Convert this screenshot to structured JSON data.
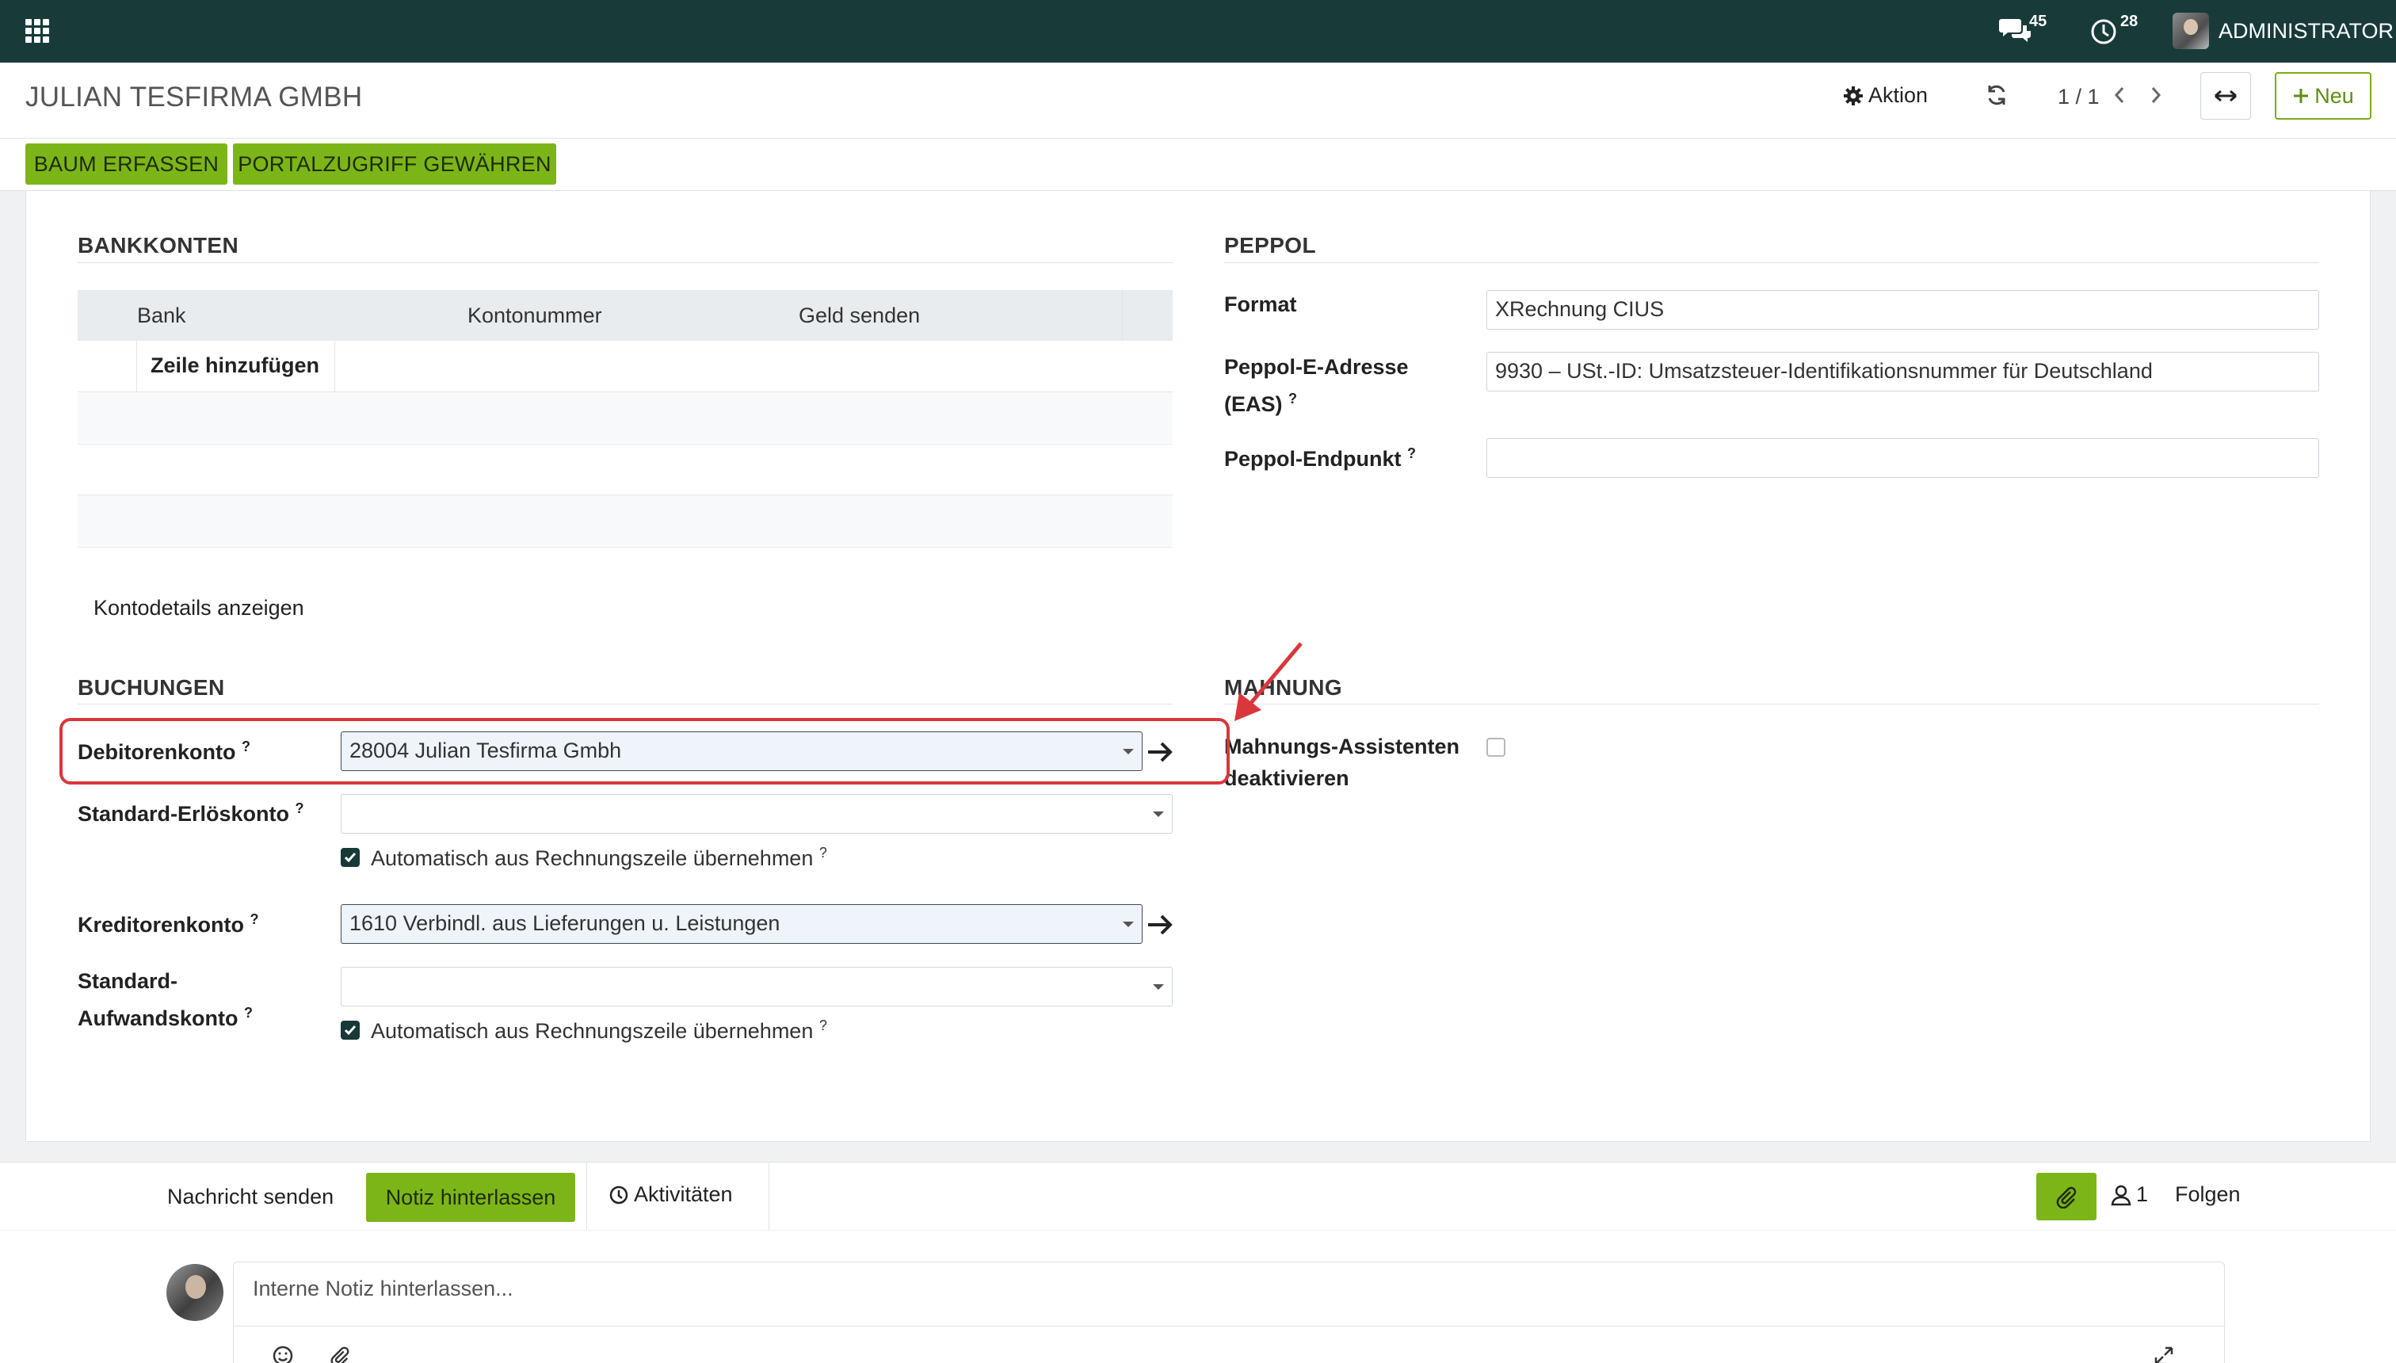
{
  "navbar": {
    "messages_count": "45",
    "activities_count": "28",
    "user_name": "ADMINISTRATOR"
  },
  "control_panel": {
    "record_title": "JULIAN TESFIRMA GMBH",
    "action_label": "Aktion",
    "pager": "1 / 1",
    "new_label": "Neu"
  },
  "status_buttons": {
    "tree": "BAUM ERFASSEN",
    "portal": "PORTALZUGRIFF GEWÄHREN"
  },
  "bank_section": {
    "title": "BANKKONTEN",
    "columns": [
      "Bank",
      "Kontonummer",
      "Geld senden"
    ],
    "add_line": "Zeile hinzufügen",
    "show_details": "Kontodetails anzeigen"
  },
  "peppol_section": {
    "title": "PEPPOL",
    "format_label": "Format",
    "format_value": "XRechnung CIUS",
    "eas_label_1": "Peppol-E-Adresse",
    "eas_label_2": "(EAS)",
    "eas_value": "9930 – USt.-ID: Umsatzsteuer-Identifikationsnummer für Deutschland",
    "endpoint_label": "Peppol-Endpunkt",
    "endpoint_value": ""
  },
  "bookings_section": {
    "title": "BUCHUNGEN",
    "receivable_label": "Debitorenkonto",
    "receivable_value": "28004 Julian Tesfirma Gmbh",
    "income_label": "Standard-Erlöskonto",
    "income_value": "",
    "income_auto_label": "Automatisch aus Rechnungszeile übernehmen",
    "income_auto_checked": true,
    "payable_label": "Kreditorenkonto",
    "payable_value": "1610 Verbindl. aus Lieferungen u. Leistungen",
    "expense_label_1": "Standard-",
    "expense_label_2": "Aufwandskonto",
    "expense_value": "",
    "expense_auto_label": "Automatisch aus Rechnungszeile übernehmen",
    "expense_auto_checked": true
  },
  "dunning_section": {
    "title": "MAHNUNG",
    "disable_label_1": "Mahnungs-Assistenten",
    "disable_label_2": "deaktivieren",
    "disable_checked": false
  },
  "help_mark": "?",
  "chatter": {
    "send_message": "Nachricht senden",
    "log_note": "Notiz hinterlassen",
    "activities": "Aktivitäten",
    "followers_count": "1",
    "follow": "Folgen",
    "composer_placeholder": "Interne Notiz hinterlassen..."
  },
  "colors": {
    "navbar": "#183b3a",
    "accent_green": "#7cb518",
    "highlight_red": "#d9373b"
  }
}
